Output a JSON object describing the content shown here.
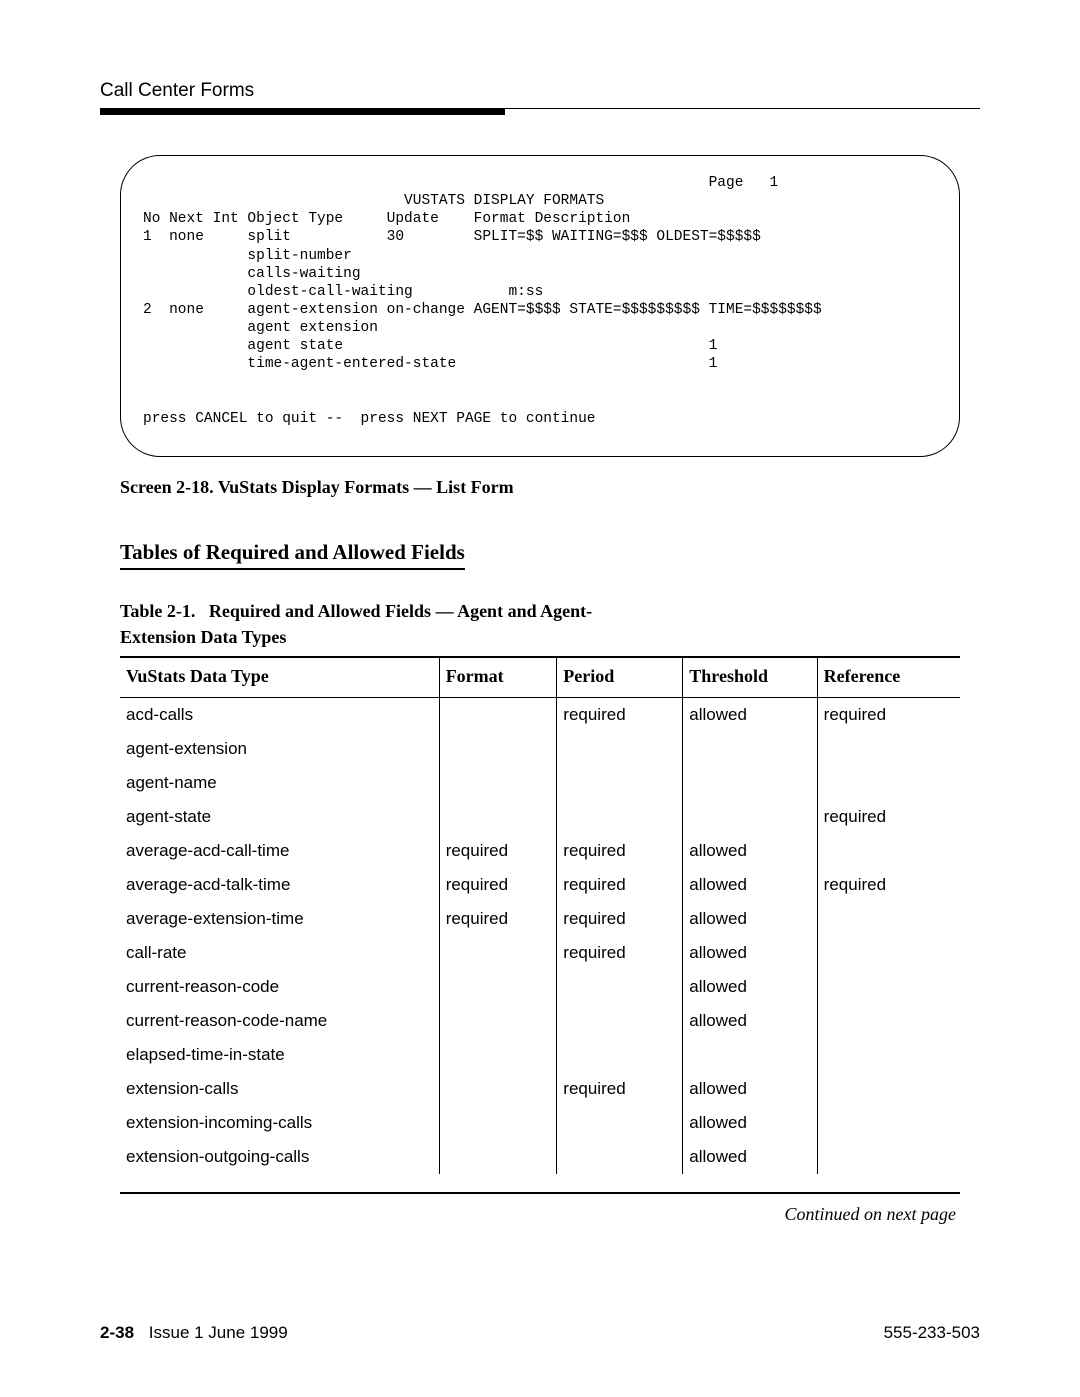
{
  "header": {
    "running": "Call Center Forms"
  },
  "terminal": {
    "text": "                                                                 Page   1\n                              VUSTATS DISPLAY FORMATS\nNo Next Int Object Type     Update    Format Description\n1  none     split           30        SPLIT=$$ WAITING=$$$ OLDEST=$$$$$\n            split-number\n            calls-waiting\n            oldest-call-waiting           m:ss\n2  none     agent-extension on-change AGENT=$$$$ STATE=$$$$$$$$$ TIME=$$$$$$$$\n            agent extension\n            agent state                                          1\n            time-agent-entered-state                             1\n\n\npress CANCEL to quit --  press NEXT PAGE to continue"
  },
  "captions": {
    "screen": "Screen 2-18.   VuStats Display Formats — List Form",
    "section": "Tables of Required and Allowed Fields",
    "table_label": "Table 2-1.",
    "table_title": "Required and Allowed Fields — Agent and Agent-Extension Data Types",
    "continued": "Continued on next page"
  },
  "table": {
    "headers": [
      "VuStats Data Type",
      "Format",
      "Period",
      "Threshold",
      "Reference"
    ],
    "rows": [
      {
        "c0": "acd-calls",
        "c1": "",
        "c2": "required",
        "c3": "allowed",
        "c4": "required"
      },
      {
        "c0": "agent-extension",
        "c1": "",
        "c2": "",
        "c3": "",
        "c4": ""
      },
      {
        "c0": "agent-name",
        "c1": "",
        "c2": "",
        "c3": "",
        "c4": ""
      },
      {
        "c0": "agent-state",
        "c1": "",
        "c2": "",
        "c3": "",
        "c4": "required"
      },
      {
        "c0": "average-acd-call-time",
        "c1": "required",
        "c2": "required",
        "c3": "allowed",
        "c4": ""
      },
      {
        "c0": "average-acd-talk-time",
        "c1": "required",
        "c2": "required",
        "c3": "allowed",
        "c4": "required"
      },
      {
        "c0": "average-extension-time",
        "c1": "required",
        "c2": "required",
        "c3": "allowed",
        "c4": ""
      },
      {
        "c0": "call-rate",
        "c1": "",
        "c2": "required",
        "c3": "allowed",
        "c4": ""
      },
      {
        "c0": "current-reason-code",
        "c1": "",
        "c2": "",
        "c3": "allowed",
        "c4": ""
      },
      {
        "c0": "current-reason-code-name",
        "c1": "",
        "c2": "",
        "c3": "allowed",
        "c4": ""
      },
      {
        "c0": "elapsed-time-in-state",
        "c1": "",
        "c2": "",
        "c3": "",
        "c4": ""
      },
      {
        "c0": "extension-calls",
        "c1": "",
        "c2": "required",
        "c3": "allowed",
        "c4": ""
      },
      {
        "c0": "extension-incoming-calls",
        "c1": "",
        "c2": "",
        "c3": "allowed",
        "c4": ""
      },
      {
        "c0": "extension-outgoing-calls",
        "c1": "",
        "c2": "",
        "c3": "allowed",
        "c4": ""
      }
    ]
  },
  "footer": {
    "pagenum": "2-38",
    "issue": "Issue 1 June 1999",
    "docnum": "555-233-503"
  }
}
